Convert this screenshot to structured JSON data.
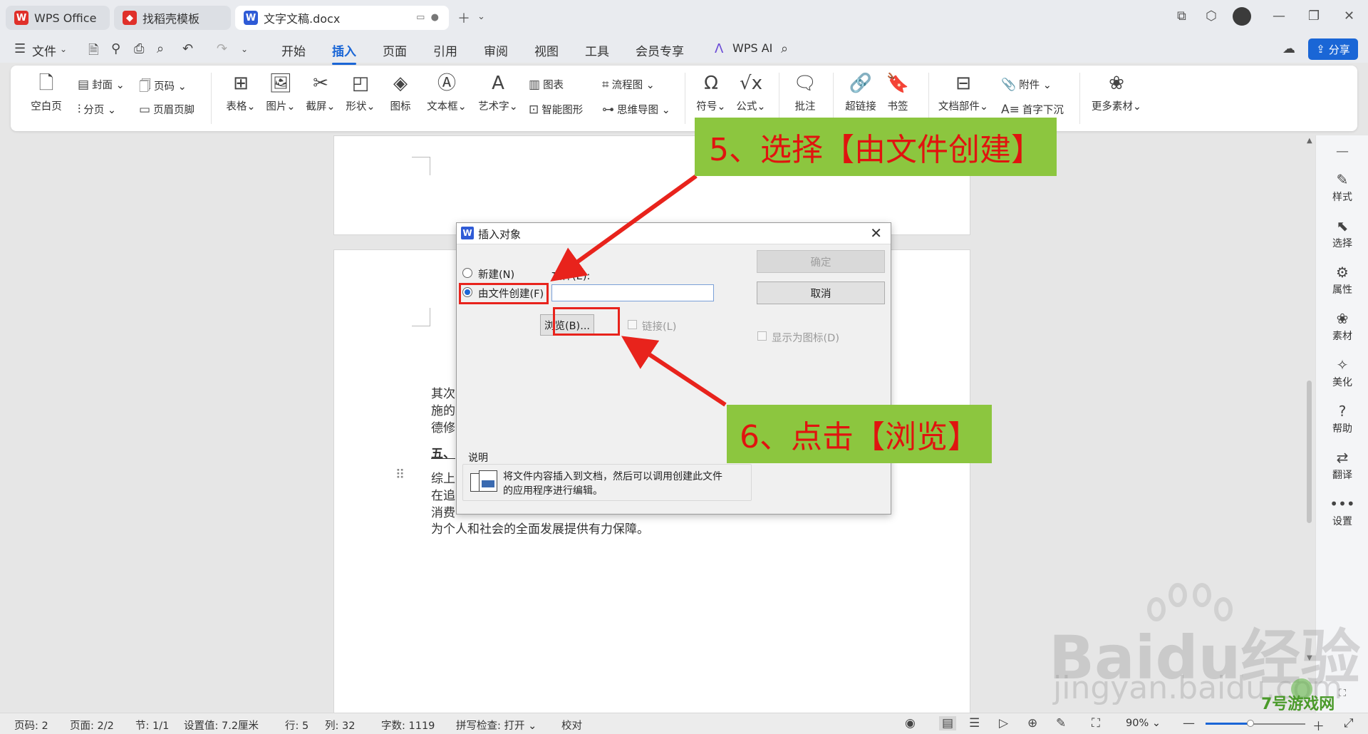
{
  "tabs": [
    {
      "label": "WPS Office"
    },
    {
      "label": "找稻壳模板"
    },
    {
      "label": "文字文稿.docx"
    }
  ],
  "menu": {
    "file": "文件",
    "items": [
      "开始",
      "插入",
      "页面",
      "引用",
      "审阅",
      "视图",
      "工具",
      "会员专享"
    ],
    "active": "插入",
    "wps_ai": "WPS AI",
    "share": "分享"
  },
  "ribbon": {
    "blank_page": "空白页",
    "cover": "封面",
    "page_number": "页码",
    "section_break": "分页",
    "header_footer": "页眉页脚",
    "table": "表格",
    "picture": "图片",
    "screenshot": "截屏",
    "shape": "形状",
    "icon": "图标",
    "textbox": "文本框",
    "wordart": "艺术字",
    "chart": "图表",
    "smart_graphic": "智能图形",
    "flowchart": "流程图",
    "mindmap": "思维导图",
    "symbol": "符号",
    "formula": "公式",
    "comment": "批注",
    "hyperlink": "超链接",
    "bookmark": "书签",
    "doc_parts": "文档部件",
    "attachment": "附件",
    "drop_cap": "首字下沉",
    "more_materials": "更多素材"
  },
  "document": {
    "lines": [
      "其次",
      "施的",
      "德修",
      "五、",
      "综上",
      "在追",
      "消费",
      "为个人和社会的全面发展提供有力保障。"
    ]
  },
  "right_panel": [
    "样式",
    "选择",
    "属性",
    "素材",
    "美化",
    "帮助",
    "翻译",
    "设置"
  ],
  "status": {
    "page_code": "页码: 2",
    "pages": "页面: 2/2",
    "section": "节: 1/1",
    "setting": "设置值: 7.2厘米",
    "row": "行: 5",
    "col": "列: 32",
    "words": "字数: 1119",
    "spell": "拼写检查: 打开",
    "proofread": "校对",
    "zoom": "90%"
  },
  "dialog": {
    "title": "插入对象",
    "opt_new": "新建(N)",
    "opt_from_file": "由文件创建(F)",
    "file_label": "文件(E):",
    "file_value": "",
    "browse": "浏览(B)...",
    "link": "链接(L)",
    "ok": "确定",
    "cancel": "取消",
    "show_as_icon": "显示为图标(D)",
    "desc_title": "说明",
    "desc_text_1": "将文件内容插入到文档，然后可以调用创建此文件",
    "desc_text_2": "的应用程序进行编辑。"
  },
  "annotations": {
    "step5": "5、选择【由文件创建】",
    "step6": "6、点击【浏览】"
  },
  "watermark": {
    "text": "Baidu经验",
    "url": "jingyan.baidu.com",
    "logo": "7号游戏网"
  },
  "colors": {
    "accent": "#1a66d6",
    "callout_bg": "#8cc63f",
    "callout_text": "#e0140f",
    "highlight": "#e8231c"
  }
}
